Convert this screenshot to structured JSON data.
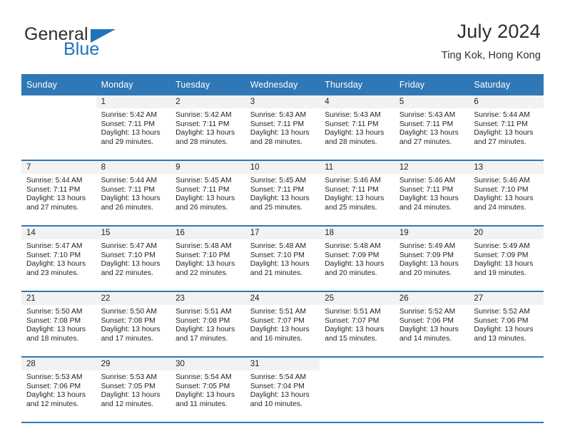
{
  "brand": {
    "name_top": "General",
    "name_bottom": "Blue",
    "color_blue": "#1f72bd",
    "color_dark": "#2e2e2e"
  },
  "header": {
    "title": "July 2024",
    "subtitle": "Ting Kok, Hong Kong"
  },
  "theme": {
    "header_row_bg": "#2f77b5",
    "daynum_band_bg": "#f2f2f2",
    "row_separator": "#2f77b5",
    "text": "#231f20"
  },
  "weekdays": [
    "Sunday",
    "Monday",
    "Tuesday",
    "Wednesday",
    "Thursday",
    "Friday",
    "Saturday"
  ],
  "labels": {
    "sunrise_prefix": "Sunrise:",
    "sunset_prefix": "Sunset:",
    "daylight_prefix": "Daylight:"
  },
  "weeks": [
    [
      {
        "day": ""
      },
      {
        "day": "1",
        "sunrise": "Sunrise: 5:42 AM",
        "sunset": "Sunset: 7:11 PM",
        "daylight_line1": "Daylight: 13 hours",
        "daylight_line2": "and 29 minutes."
      },
      {
        "day": "2",
        "sunrise": "Sunrise: 5:42 AM",
        "sunset": "Sunset: 7:11 PM",
        "daylight_line1": "Daylight: 13 hours",
        "daylight_line2": "and 28 minutes."
      },
      {
        "day": "3",
        "sunrise": "Sunrise: 5:43 AM",
        "sunset": "Sunset: 7:11 PM",
        "daylight_line1": "Daylight: 13 hours",
        "daylight_line2": "and 28 minutes."
      },
      {
        "day": "4",
        "sunrise": "Sunrise: 5:43 AM",
        "sunset": "Sunset: 7:11 PM",
        "daylight_line1": "Daylight: 13 hours",
        "daylight_line2": "and 28 minutes."
      },
      {
        "day": "5",
        "sunrise": "Sunrise: 5:43 AM",
        "sunset": "Sunset: 7:11 PM",
        "daylight_line1": "Daylight: 13 hours",
        "daylight_line2": "and 27 minutes."
      },
      {
        "day": "6",
        "sunrise": "Sunrise: 5:44 AM",
        "sunset": "Sunset: 7:11 PM",
        "daylight_line1": "Daylight: 13 hours",
        "daylight_line2": "and 27 minutes."
      }
    ],
    [
      {
        "day": "7",
        "sunrise": "Sunrise: 5:44 AM",
        "sunset": "Sunset: 7:11 PM",
        "daylight_line1": "Daylight: 13 hours",
        "daylight_line2": "and 27 minutes."
      },
      {
        "day": "8",
        "sunrise": "Sunrise: 5:44 AM",
        "sunset": "Sunset: 7:11 PM",
        "daylight_line1": "Daylight: 13 hours",
        "daylight_line2": "and 26 minutes."
      },
      {
        "day": "9",
        "sunrise": "Sunrise: 5:45 AM",
        "sunset": "Sunset: 7:11 PM",
        "daylight_line1": "Daylight: 13 hours",
        "daylight_line2": "and 26 minutes."
      },
      {
        "day": "10",
        "sunrise": "Sunrise: 5:45 AM",
        "sunset": "Sunset: 7:11 PM",
        "daylight_line1": "Daylight: 13 hours",
        "daylight_line2": "and 25 minutes."
      },
      {
        "day": "11",
        "sunrise": "Sunrise: 5:46 AM",
        "sunset": "Sunset: 7:11 PM",
        "daylight_line1": "Daylight: 13 hours",
        "daylight_line2": "and 25 minutes."
      },
      {
        "day": "12",
        "sunrise": "Sunrise: 5:46 AM",
        "sunset": "Sunset: 7:11 PM",
        "daylight_line1": "Daylight: 13 hours",
        "daylight_line2": "and 24 minutes."
      },
      {
        "day": "13",
        "sunrise": "Sunrise: 5:46 AM",
        "sunset": "Sunset: 7:10 PM",
        "daylight_line1": "Daylight: 13 hours",
        "daylight_line2": "and 24 minutes."
      }
    ],
    [
      {
        "day": "14",
        "sunrise": "Sunrise: 5:47 AM",
        "sunset": "Sunset: 7:10 PM",
        "daylight_line1": "Daylight: 13 hours",
        "daylight_line2": "and 23 minutes."
      },
      {
        "day": "15",
        "sunrise": "Sunrise: 5:47 AM",
        "sunset": "Sunset: 7:10 PM",
        "daylight_line1": "Daylight: 13 hours",
        "daylight_line2": "and 22 minutes."
      },
      {
        "day": "16",
        "sunrise": "Sunrise: 5:48 AM",
        "sunset": "Sunset: 7:10 PM",
        "daylight_line1": "Daylight: 13 hours",
        "daylight_line2": "and 22 minutes."
      },
      {
        "day": "17",
        "sunrise": "Sunrise: 5:48 AM",
        "sunset": "Sunset: 7:10 PM",
        "daylight_line1": "Daylight: 13 hours",
        "daylight_line2": "and 21 minutes."
      },
      {
        "day": "18",
        "sunrise": "Sunrise: 5:48 AM",
        "sunset": "Sunset: 7:09 PM",
        "daylight_line1": "Daylight: 13 hours",
        "daylight_line2": "and 20 minutes."
      },
      {
        "day": "19",
        "sunrise": "Sunrise: 5:49 AM",
        "sunset": "Sunset: 7:09 PM",
        "daylight_line1": "Daylight: 13 hours",
        "daylight_line2": "and 20 minutes."
      },
      {
        "day": "20",
        "sunrise": "Sunrise: 5:49 AM",
        "sunset": "Sunset: 7:09 PM",
        "daylight_line1": "Daylight: 13 hours",
        "daylight_line2": "and 19 minutes."
      }
    ],
    [
      {
        "day": "21",
        "sunrise": "Sunrise: 5:50 AM",
        "sunset": "Sunset: 7:08 PM",
        "daylight_line1": "Daylight: 13 hours",
        "daylight_line2": "and 18 minutes."
      },
      {
        "day": "22",
        "sunrise": "Sunrise: 5:50 AM",
        "sunset": "Sunset: 7:08 PM",
        "daylight_line1": "Daylight: 13 hours",
        "daylight_line2": "and 17 minutes."
      },
      {
        "day": "23",
        "sunrise": "Sunrise: 5:51 AM",
        "sunset": "Sunset: 7:08 PM",
        "daylight_line1": "Daylight: 13 hours",
        "daylight_line2": "and 17 minutes."
      },
      {
        "day": "24",
        "sunrise": "Sunrise: 5:51 AM",
        "sunset": "Sunset: 7:07 PM",
        "daylight_line1": "Daylight: 13 hours",
        "daylight_line2": "and 16 minutes."
      },
      {
        "day": "25",
        "sunrise": "Sunrise: 5:51 AM",
        "sunset": "Sunset: 7:07 PM",
        "daylight_line1": "Daylight: 13 hours",
        "daylight_line2": "and 15 minutes."
      },
      {
        "day": "26",
        "sunrise": "Sunrise: 5:52 AM",
        "sunset": "Sunset: 7:06 PM",
        "daylight_line1": "Daylight: 13 hours",
        "daylight_line2": "and 14 minutes."
      },
      {
        "day": "27",
        "sunrise": "Sunrise: 5:52 AM",
        "sunset": "Sunset: 7:06 PM",
        "daylight_line1": "Daylight: 13 hours",
        "daylight_line2": "and 13 minutes."
      }
    ],
    [
      {
        "day": "28",
        "sunrise": "Sunrise: 5:53 AM",
        "sunset": "Sunset: 7:06 PM",
        "daylight_line1": "Daylight: 13 hours",
        "daylight_line2": "and 12 minutes."
      },
      {
        "day": "29",
        "sunrise": "Sunrise: 5:53 AM",
        "sunset": "Sunset: 7:05 PM",
        "daylight_line1": "Daylight: 13 hours",
        "daylight_line2": "and 12 minutes."
      },
      {
        "day": "30",
        "sunrise": "Sunrise: 5:54 AM",
        "sunset": "Sunset: 7:05 PM",
        "daylight_line1": "Daylight: 13 hours",
        "daylight_line2": "and 11 minutes."
      },
      {
        "day": "31",
        "sunrise": "Sunrise: 5:54 AM",
        "sunset": "Sunset: 7:04 PM",
        "daylight_line1": "Daylight: 13 hours",
        "daylight_line2": "and 10 minutes."
      },
      {
        "day": ""
      },
      {
        "day": ""
      },
      {
        "day": ""
      }
    ]
  ]
}
